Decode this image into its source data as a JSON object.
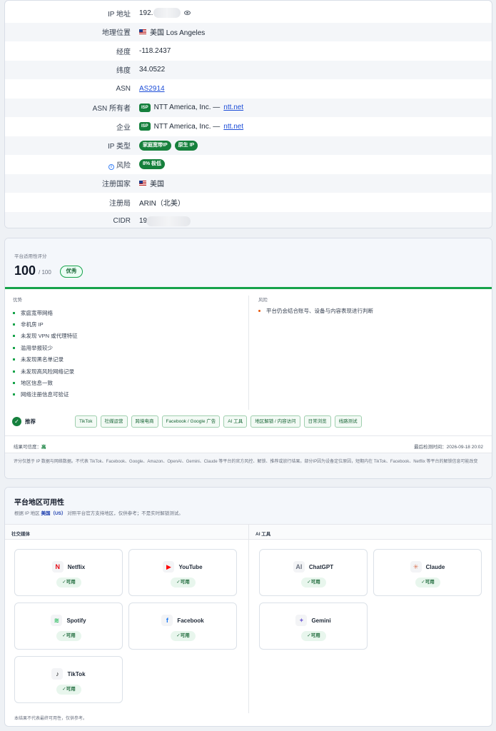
{
  "info": {
    "rows": [
      {
        "label": "IP 地址",
        "value": "192."
      },
      {
        "label": "地理位置",
        "value": "美国 Los Angeles"
      },
      {
        "label": "经度",
        "value": "-118.2437"
      },
      {
        "label": "纬度",
        "value": "34.0522"
      },
      {
        "label": "ASN",
        "value": "AS2914"
      },
      {
        "label": "ASN 所有者",
        "badge": "ISP",
        "value": "NTT America, Inc. —",
        "link": "ntt.net"
      },
      {
        "label": "企业",
        "badge": "ISP",
        "value": "NTT America, Inc. —",
        "link": "ntt.net"
      },
      {
        "label": "IP 类型",
        "tags": [
          "家庭宽带IP",
          "原生 IP"
        ]
      },
      {
        "label": "风险",
        "risk_tag": "8% 极低"
      },
      {
        "label": "注册国家",
        "value": "美国"
      },
      {
        "label": "注册局",
        "value": "ARIN（北美）"
      },
      {
        "label": "CIDR",
        "value": "19"
      }
    ]
  },
  "score": {
    "title": "平台适用性评分",
    "value": "100",
    "max": "/ 100",
    "grade": "优秀",
    "progress_percent": 100,
    "pros_title": "优势",
    "pros": [
      "家庭宽带网络",
      "非机房 IP",
      "未发现 VPN 或代理特征",
      "滥用举报较少",
      "未发现黑名单记录",
      "未发现高风险网络记录",
      "地区信息一致",
      "网络注册信息可验证"
    ],
    "risks_title": "风险",
    "risks": [
      "平台仍会结合账号、设备与内容表现进行判断"
    ],
    "recommend_label": "推荐",
    "recommend_tags": [
      "TikTok",
      "社媒运营",
      "跨境电商",
      "Facebook / Google 广告",
      "AI 工具",
      "地区解锁 / 内容访问",
      "日常浏览",
      "线路测试"
    ],
    "confidence_label": "结果可信度：",
    "confidence_value": "高",
    "last_check": "最后检测时间：2026-09-18 20:02",
    "disclaimer": "评分仅基于 IP 数据与网络数据。不代表 TikTok、Facebook、Google、Amazon、OpenAI、Gemini、Claude 等平台的官方风控、解锁、推荐或放行结果。部分IP因为设备定位原因，短期内在 TikTok、Facebook、Netflix 等平台的解锁信息可能改变"
  },
  "platform": {
    "title": "平台地区可用性",
    "sub_prefix": "根据 IP 地区",
    "sub_region": "美国（US）",
    "sub_suffix": "对照平台官方支持地区，仅供参考；不是实时解锁测试。",
    "social_label": "社交媒体",
    "ai_label": "AI 工具",
    "social": [
      {
        "name": "Netflix",
        "icon": "netflix-icon",
        "glyph": "N",
        "color": "#e50914",
        "status": "✓可用"
      },
      {
        "name": "YouTube",
        "icon": "youtube-icon",
        "glyph": "▶",
        "color": "#ff0000",
        "status": "✓可用"
      },
      {
        "name": "Spotify",
        "icon": "spotify-icon",
        "glyph": "≋",
        "color": "#1db954",
        "status": "✓可用"
      },
      {
        "name": "Facebook",
        "icon": "facebook-icon",
        "glyph": "f",
        "color": "#1877f2",
        "status": "✓可用"
      },
      {
        "name": "TikTok",
        "icon": "tiktok-icon",
        "glyph": "♪",
        "color": "#111111",
        "status": "✓可用"
      }
    ],
    "ai": [
      {
        "name": "ChatGPT",
        "icon": "chatgpt-icon",
        "glyph": "AI",
        "color": "#6b7280",
        "status": "✓可用"
      },
      {
        "name": "Claude",
        "icon": "claude-icon",
        "glyph": "✳",
        "color": "#d97757",
        "status": "✓可用"
      },
      {
        "name": "Gemini",
        "icon": "gemini-icon",
        "glyph": "✦",
        "color": "#7c6bd6",
        "status": "✓可用"
      }
    ],
    "footer": "本结果不代表最终可用性，仅供参考。"
  }
}
